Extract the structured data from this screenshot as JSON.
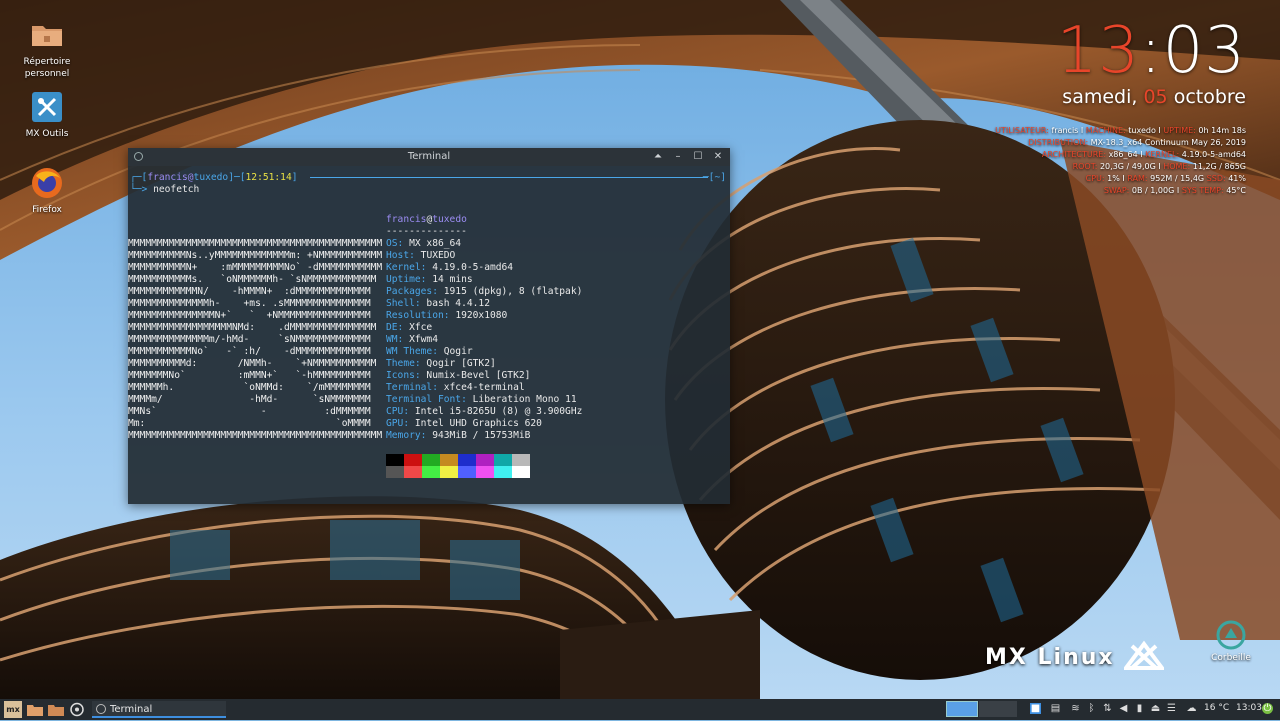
{
  "desktop": {
    "icons": [
      {
        "label_line1": "Répertoire",
        "label_line2": "personnel",
        "icon": "folder-home-icon"
      },
      {
        "label_line1": "MX Outils",
        "label_line2": "",
        "icon": "mx-tools-icon"
      },
      {
        "label_line1": "Firefox",
        "label_line2": "",
        "icon": "firefox-icon"
      }
    ],
    "trash_label": "Corbeille",
    "logo_text": "MX Linux"
  },
  "conky": {
    "hours": "13",
    "minutes": ":03",
    "weekday": "samedi,",
    "day": "05",
    "month": "octobre",
    "lines": [
      {
        "k1": "UTILISATEUR:",
        "v1": " francis I ",
        "k2": "MACHINE:",
        "v2": " tuxedo I ",
        "k3": "UPTIME:",
        "v3": " 0h 14m 18s"
      },
      {
        "k1": "DISTRIBUTION:",
        "v1": " MX-18.3_x64 Continuum May 26, 2019",
        "k2": "",
        "v2": "",
        "k3": "",
        "v3": ""
      },
      {
        "k1": "ARCHITECTURE:",
        "v1": " x86_64 I ",
        "k2": "KERNEL:",
        "v2": " 4.19.0-5-amd64",
        "k3": "",
        "v3": ""
      },
      {
        "k1": "ROOT:",
        "v1": " 20,3G / 49,0G I ",
        "k2": "HOME:",
        "v2": " 11,2G / 865G",
        "k3": "",
        "v3": ""
      },
      {
        "k1": "CPU:",
        "v1": " 1% I ",
        "k2": "RAM:",
        "v2": " 952M / 15,4G ",
        "k3": "SSD:",
        "v3": " 41%"
      },
      {
        "k1": "SWAP:",
        "v1": " 0B / 1,00G I ",
        "k2": "SYS TEMP:",
        "v2": " 45°C",
        "k3": "",
        "v3": ""
      }
    ]
  },
  "terminal": {
    "title": "Terminal",
    "prompt": {
      "open": "┌─[",
      "user": "francis",
      "at": "@",
      "host": "tuxedo",
      "mid": "]─[",
      "time": "12:51:14",
      "close": "]",
      "end": "─[~]"
    },
    "command": {
      "arrow": "└─> ",
      "text": "neofetch"
    },
    "ascii": [
      "MMMMMMMMMMMMMMMMMMMMMMMMMMMMMMMMMMMMMMMMMMMM",
      "MMMMMMMMMMNs..yMMMMMMMMMMMMMm: +NMMMMMMMMMMM",
      "MMMMMMMMMMN+    :mMMMMMMMMMNo` -dMMMMMMMMMMM",
      "MMMMMMMMMMMs.   `oNMMMMMMh- `sNMMMMMMMMMMMM",
      "MMMMMMMMMMMMN/    -hMMMN+  :dMMMMMMMMMMMMM",
      "MMMMMMMMMMMMMMh-    +ms. .sMMMMMMMMMMMMMMM",
      "MMMMMMMMMMMMMMMN+`   `  +NMMMMMMMMMMMMMMMM",
      "MMMMMMMMMMMMMMMMMMNMd:    .dMMMMMMMMMMMMMMM",
      "MMMMMMMMMMMMMMm/-hMd-     `sNMMMMMMMMMMMMM",
      "MMMMMMMMMMMNo`   -` :h/    -dMMMMMMMMMMMMM",
      "MMMMMMMMMMd:       /NMMh-    `+NMMMMMMMMMMM",
      "MMMMMMMNo`         :mMMN+`   `-hMMMMMMMMMM",
      "MMMMMMh.            `oNMMd:    `/mMMMMMMMM",
      "MMMMm/               -hMd-      `sNMMMMMMM",
      "MMNs`                  -          :dMMMMMM",
      "Mm:                                 `oMMMM",
      "MMMMMMMMMMMMMMMMMMMMMMMMMMMMMMMMMMMMMMMMMMMM"
    ],
    "info_user": "francis",
    "info_at": "@",
    "info_host": "tuxedo",
    "info_rule": "--------------",
    "info": [
      {
        "key": "OS:",
        "val": " MX x86_64"
      },
      {
        "key": "Host:",
        "val": " TUXEDO"
      },
      {
        "key": "Kernel:",
        "val": " 4.19.0-5-amd64"
      },
      {
        "key": "Uptime:",
        "val": " 14 mins"
      },
      {
        "key": "Packages:",
        "val": " 1915 (dpkg), 8 (flatpak)"
      },
      {
        "key": "Shell:",
        "val": " bash 4.4.12"
      },
      {
        "key": "Resolution:",
        "val": " 1920x1080"
      },
      {
        "key": "DE:",
        "val": " Xfce"
      },
      {
        "key": "WM:",
        "val": " Xfwm4"
      },
      {
        "key": "WM Theme:",
        "val": " Qogir"
      },
      {
        "key": "Theme:",
        "val": " Qogir [GTK2]"
      },
      {
        "key": "Icons:",
        "val": " Numix-Bevel [GTK2]"
      },
      {
        "key": "Terminal:",
        "val": " xfce4-terminal"
      },
      {
        "key": "Terminal Font:",
        "val": " Liberation Mono 11"
      },
      {
        "key": "CPU:",
        "val": " Intel i5-8265U (8) @ 3.900GHz"
      },
      {
        "key": "GPU:",
        "val": " Intel UHD Graphics 620"
      },
      {
        "key": "Memory:",
        "val": " 943MiB / 15753MiB"
      }
    ],
    "palette": [
      "#000000",
      "#cc1010",
      "#22aa22",
      "#c58a20",
      "#1e2dcc",
      "#b020c0",
      "#10a8a8",
      "#b8b8b8",
      "#555555",
      "#f04848",
      "#44ee44",
      "#f0f044",
      "#5060ff",
      "#f050f0",
      "#40f0f0",
      "#ffffff"
    ]
  },
  "taskbar": {
    "menu_label": "mx",
    "task_label": "Terminal",
    "weather": "16 °C",
    "clock": "13:03"
  }
}
